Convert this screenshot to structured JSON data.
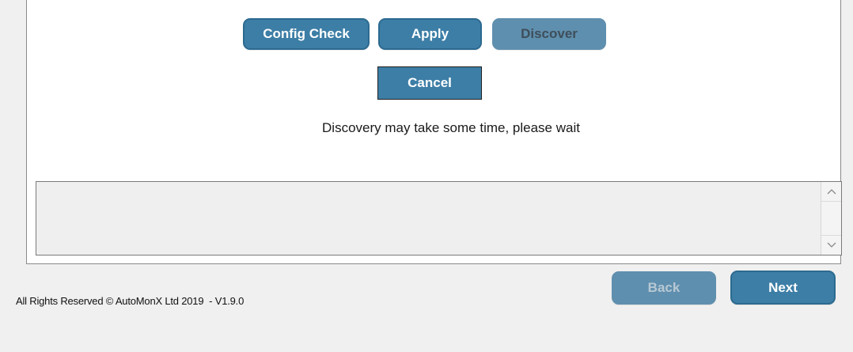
{
  "buttons": {
    "config_check": "Config Check",
    "apply": "Apply",
    "discover": "Discover",
    "cancel": "Cancel",
    "back": "Back",
    "next": "Next"
  },
  "status": {
    "message": "Discovery may take some time, please wait"
  },
  "footer": {
    "copyright": "All Rights Reserved © AutoMonX Ltd 2019",
    "version": "  - V1.9.0"
  },
  "log": {
    "text": ""
  },
  "colors": {
    "button_blue": "#3d7ea6",
    "button_disabled": "#5f8fae",
    "background": "#f0f0f0",
    "panel": "#ffffff"
  },
  "icons": {
    "scroll_up": "chevron-up-icon",
    "scroll_down": "chevron-down-icon"
  }
}
